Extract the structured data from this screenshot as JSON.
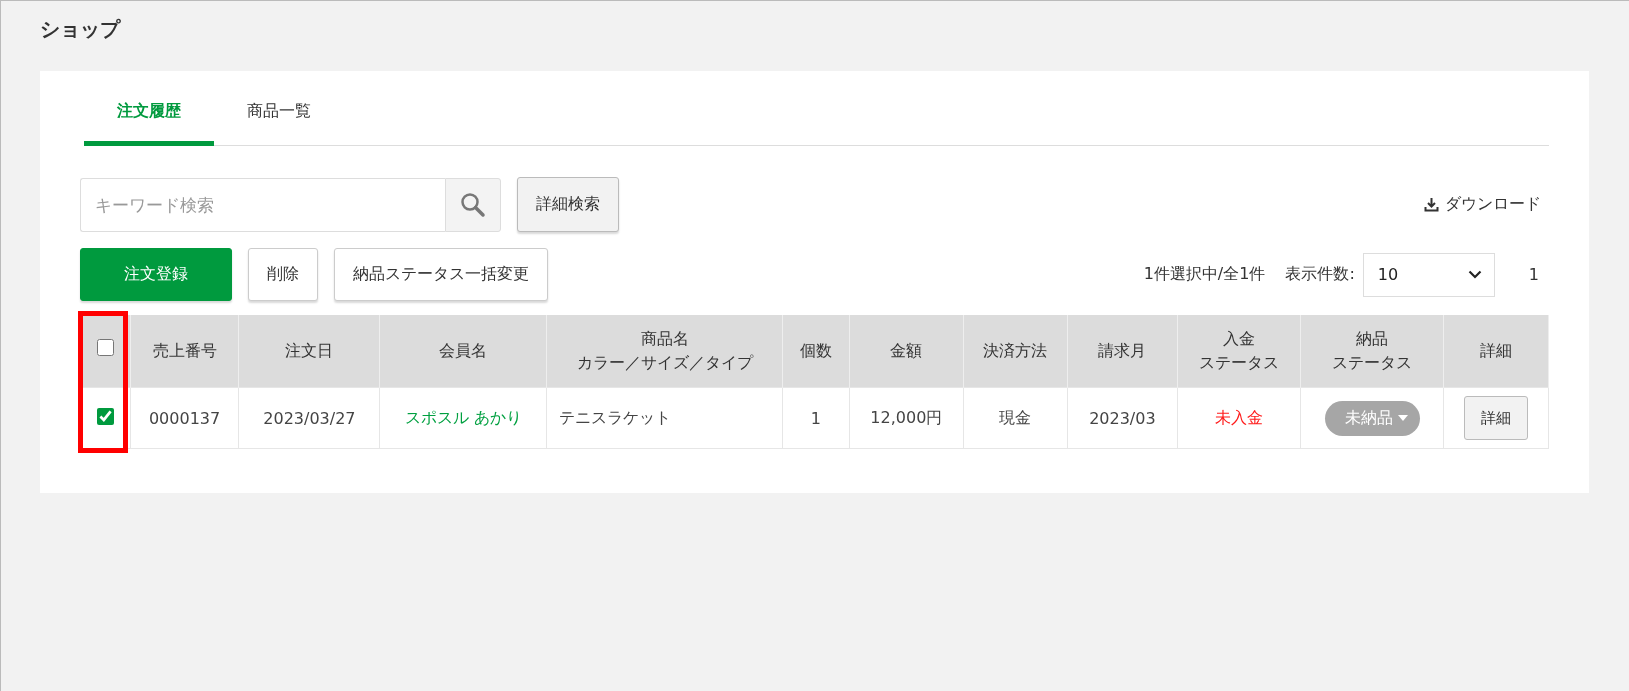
{
  "page_title": "ショップ",
  "tabs": [
    {
      "label": "注文履歴",
      "selected": true
    },
    {
      "label": "商品一覧",
      "selected": false
    }
  ],
  "search": {
    "placeholder": "キーワード検索",
    "advanced_button": "詳細検索"
  },
  "download": "ダウンロード",
  "actions": [
    {
      "label": "注文登録",
      "kind": "primary"
    },
    {
      "label": "削除",
      "kind": "default"
    },
    {
      "label": "納品ステータス一括変更",
      "kind": "default"
    }
  ],
  "summary": "1件選択中/全1件",
  "per_page": {
    "label": "表示件数:",
    "value": "10"
  },
  "page": "1",
  "table": {
    "select_all_checked": false,
    "columns": [
      {
        "label": "売上番号"
      },
      {
        "label": "注文日"
      },
      {
        "label": "会員名"
      },
      {
        "label": "商品名",
        "sublabel": "カラー／サイズ／タイプ"
      },
      {
        "label": "個数"
      },
      {
        "label": "金額"
      },
      {
        "label": "決済方法"
      },
      {
        "label": "請求月"
      },
      {
        "label": "入金",
        "sublabel": "ステータス"
      },
      {
        "label": "納品",
        "sublabel": "ステータス"
      },
      {
        "label": "詳細"
      }
    ],
    "rows": [
      {
        "checked": true,
        "cells": [
          {
            "kind": "text",
            "text": "0000137"
          },
          {
            "kind": "text",
            "text": "2023/03/27"
          },
          {
            "kind": "link",
            "text": "スポスル あかり"
          },
          {
            "kind": "product",
            "text": "テニスラケット"
          },
          {
            "kind": "text",
            "text": "1"
          },
          {
            "kind": "text",
            "text": "12,000円"
          },
          {
            "kind": "text",
            "text": "現金"
          },
          {
            "kind": "text",
            "text": "2023/03"
          },
          {
            "kind": "alert",
            "text": "未入金"
          },
          {
            "kind": "dropdown",
            "text": "未納品"
          },
          {
            "kind": "button",
            "text": "詳細"
          }
        ]
      }
    ]
  }
}
